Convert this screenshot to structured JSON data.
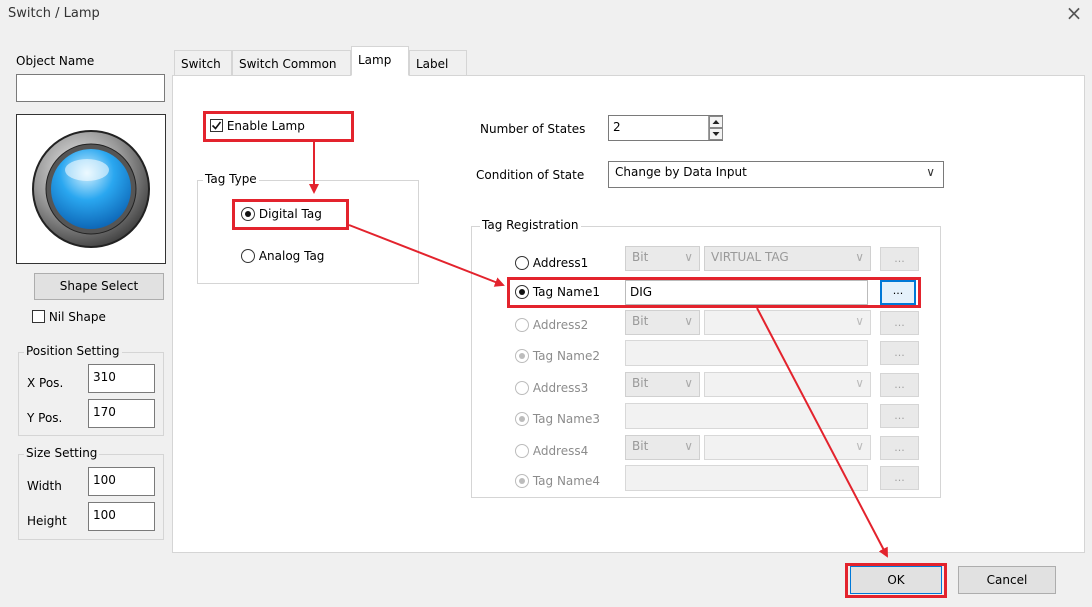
{
  "window": {
    "title": "Switch / Lamp",
    "close_glyph": "×"
  },
  "left": {
    "object_name_label": "Object Name",
    "object_name_value": "",
    "shape_select_label": "Shape Select",
    "nil_shape_label": "Nil Shape",
    "nil_shape_checked": false,
    "position_setting_label": "Position Setting",
    "x_label": "X Pos.",
    "x_value": "310",
    "y_label": "Y Pos.",
    "y_value": "170",
    "size_setting_label": "Size Setting",
    "width_label": "Width",
    "width_value": "100",
    "height_label": "Height",
    "height_value": "100"
  },
  "tabs": [
    {
      "label": "Switch",
      "active": false
    },
    {
      "label": "Switch Common",
      "active": false
    },
    {
      "label": "Lamp",
      "active": true
    },
    {
      "label": "Label",
      "active": false
    }
  ],
  "lamp": {
    "enable_lamp_label": "Enable Lamp",
    "enable_lamp_checked": true,
    "tag_type_label": "Tag Type",
    "digital_tag_label": "Digital Tag",
    "analog_tag_label": "Analog Tag",
    "selected_tag_type": "Digital Tag",
    "number_of_states_label": "Number of States",
    "number_of_states_value": "2",
    "condition_of_state_label": "Condition of State",
    "condition_of_state_value": "Change by Data Input",
    "tag_registration_label": "Tag Registration",
    "rows": [
      {
        "label": "Address1",
        "type": "address",
        "bit": "Bit",
        "value": "VIRTUAL TAG",
        "selected": false,
        "enabled": true
      },
      {
        "label": "Tag Name1",
        "type": "tag",
        "value": "DIG",
        "selected": true,
        "enabled": true
      },
      {
        "label": "Address2",
        "type": "address",
        "bit": "Bit",
        "value": "",
        "selected": false,
        "enabled": false
      },
      {
        "label": "Tag Name2",
        "type": "tag",
        "value": "",
        "selected": true,
        "enabled": false
      },
      {
        "label": "Address3",
        "type": "address",
        "bit": "Bit",
        "value": "",
        "selected": false,
        "enabled": false
      },
      {
        "label": "Tag Name3",
        "type": "tag",
        "value": "",
        "selected": true,
        "enabled": false
      },
      {
        "label": "Address4",
        "type": "address",
        "bit": "Bit",
        "value": "",
        "selected": false,
        "enabled": false
      },
      {
        "label": "Tag Name4",
        "type": "tag",
        "value": "",
        "selected": true,
        "enabled": false
      }
    ],
    "browse_label": "...",
    "dropdown_glyph": "∨"
  },
  "footer": {
    "ok_label": "OK",
    "cancel_label": "Cancel"
  },
  "colors": {
    "highlight": "#e3232d",
    "focus_blue": "#0078d7",
    "lamp_blue": "#2aa7f0"
  }
}
